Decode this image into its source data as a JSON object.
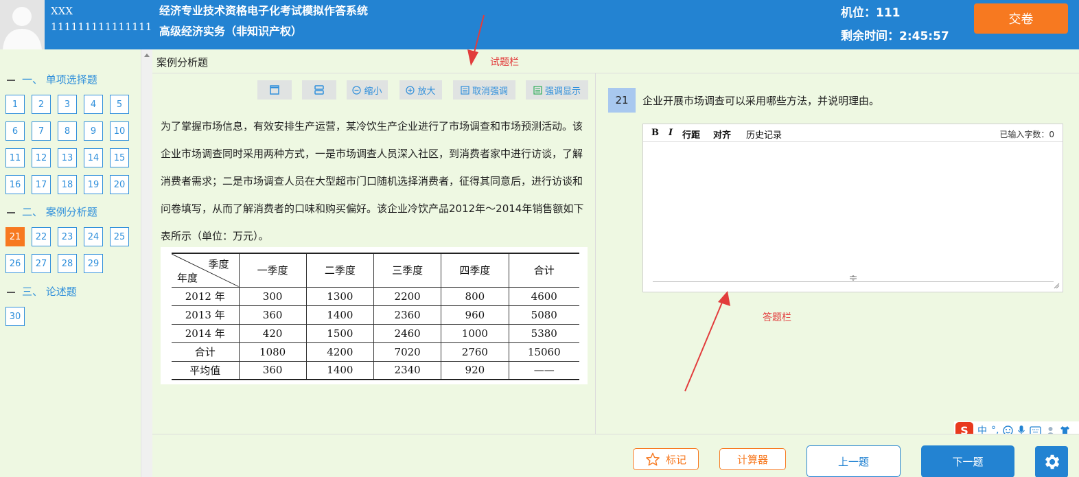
{
  "header": {
    "user_name": "XXX",
    "user_id": "111111111111111",
    "system_title": "经济专业技术资格电子化考试模拟作答系统",
    "subject": "高级经济实务（非知识产权）",
    "seat_label": "机位：111",
    "timer_label": "剩余时间：2:45:57",
    "submit_label": "交卷"
  },
  "sidebar": {
    "sections": [
      {
        "title": "一、  单项选择题",
        "questions": [
          "1",
          "2",
          "3",
          "4",
          "5",
          "6",
          "7",
          "8",
          "9",
          "10",
          "11",
          "12",
          "13",
          "14",
          "15",
          "16",
          "17",
          "18",
          "19",
          "20"
        ]
      },
      {
        "title": "二、  案例分析题",
        "questions": [
          "21",
          "22",
          "23",
          "24",
          "25",
          "26",
          "27",
          "28",
          "29"
        ]
      },
      {
        "title": "三、  论述题",
        "questions": [
          "30"
        ]
      }
    ],
    "active_question": "21"
  },
  "main": {
    "question_type": "案例分析题",
    "hint_question_area": "试题栏",
    "hint_answer_area": "答题栏",
    "toolbar": {
      "shrink": "缩小",
      "enlarge": "放大",
      "cancel_highlight": "取消强调",
      "highlight": "强调显示"
    },
    "stem": "为了掌握市场信息，有效安排生产运营，某冷饮生产企业进行了市场调查和市场预测活动。该企业市场调查同时采用两种方式，一是市场调查人员深入社区，到消费者家中进行访谈，了解消费者需求；二是市场调查人员在大型超市门口随机选择消费者，征得其同意后，进行访谈和问卷填写，从而了解消费者的口味和购买偏好。该企业冷饮产品2012年～2014年销售额如下表所示（单位：万元）。",
    "table": {
      "corner_top": "季度",
      "corner_bottom": "年度",
      "columns": [
        "一季度",
        "二季度",
        "三季度",
        "四季度",
        "合计"
      ],
      "rows": [
        {
          "label": "2012 年",
          "values": [
            "300",
            "1300",
            "2200",
            "800",
            "4600"
          ]
        },
        {
          "label": "2013 年",
          "values": [
            "360",
            "1400",
            "2360",
            "960",
            "5080"
          ]
        },
        {
          "label": "2014 年",
          "values": [
            "420",
            "1500",
            "2460",
            "1000",
            "5380"
          ]
        },
        {
          "label": "合计",
          "values": [
            "1080",
            "4200",
            "7020",
            "2760",
            "15060"
          ]
        },
        {
          "label": "平均值",
          "values": [
            "360",
            "1400",
            "2340",
            "920",
            "——"
          ]
        }
      ]
    },
    "question_number": "21",
    "question_text": "企业开展市场调查可以采用哪些方法，并说明理由。",
    "editor": {
      "bold": "B",
      "italic": "I",
      "line_spacing": "行距",
      "align": "对齐",
      "history": "历史记录",
      "char_count": "已输入字数：0",
      "value": ""
    }
  },
  "footer": {
    "mark": "标记",
    "calculator": "计算器",
    "prev": "上一题",
    "next": "下一题"
  },
  "ime": {
    "logo": "S",
    "lang": "中",
    "punct": "°,"
  }
}
